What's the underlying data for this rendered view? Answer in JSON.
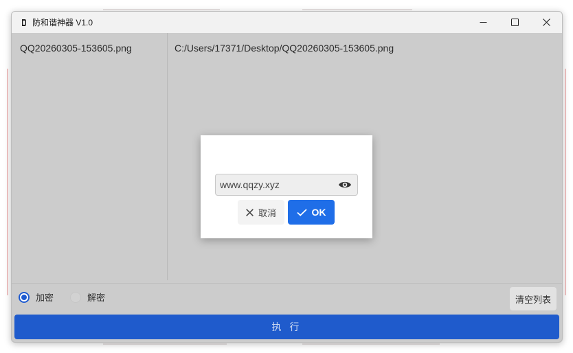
{
  "window": {
    "title": "防和谐神器 V1.0"
  },
  "file_list": {
    "items": [
      "QQ20260305-153605.png"
    ]
  },
  "details": {
    "path": "C:/Users/17371/Desktop/QQ20260305-153605.png"
  },
  "mode": {
    "options": [
      {
        "label": "加密",
        "selected": true
      },
      {
        "label": "解密",
        "selected": false
      }
    ]
  },
  "actions": {
    "clear_label": "清空列表",
    "execute_label": "执 行"
  },
  "dialog": {
    "password_value": "www.qqzy.xyz",
    "cancel_label": "取消",
    "ok_label": "OK"
  },
  "icons": {
    "app": "app-icon",
    "minimize": "minimize-icon",
    "maximize": "maximize-icon",
    "close": "close-icon",
    "eye": "eye-icon",
    "cancel": "x-icon",
    "ok": "check-icon"
  },
  "colors": {
    "accent": "#1f5bcc",
    "ok_button": "#1f6ee8",
    "window_bg": "#cccccc"
  }
}
